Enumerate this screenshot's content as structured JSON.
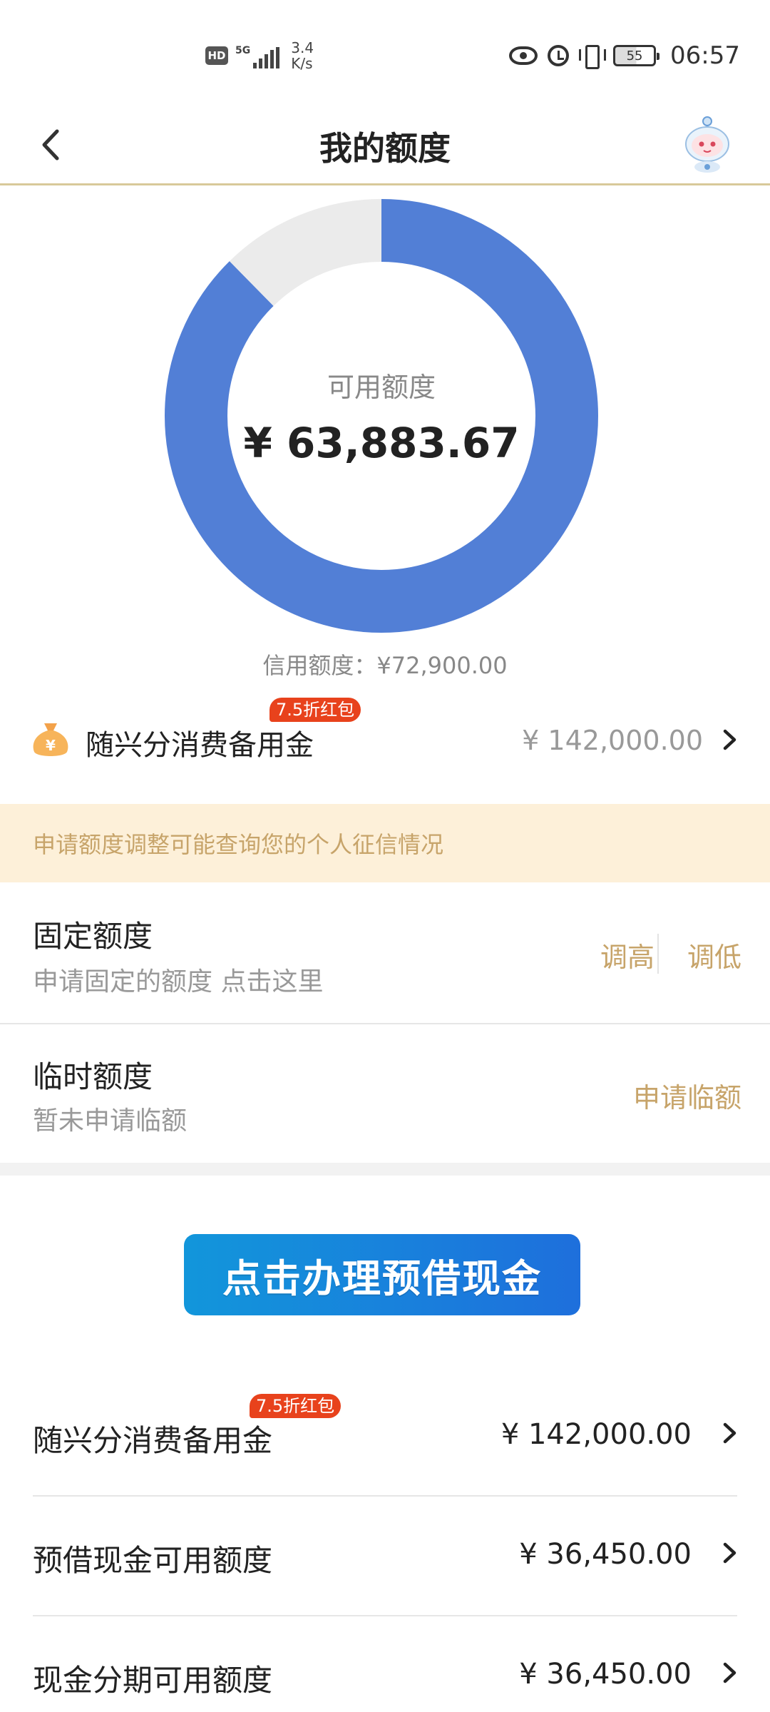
{
  "status_bar": {
    "hd": "HD",
    "network": "5G",
    "speed_value": "3.4",
    "speed_unit": "K/s",
    "battery": "55",
    "time": "06:57",
    "icons": [
      "eye-icon",
      "alarm-icon",
      "vibrate-icon",
      "battery-icon"
    ]
  },
  "header": {
    "title": "我的额度",
    "back_icon": "chevron-left-icon",
    "avatar_icon": "robot-assistant-icon"
  },
  "credit_summary": {
    "available_label": "可用额度",
    "available_amount": "¥ 63,883.67",
    "credit_limit_label": "信用额度：",
    "credit_limit_value": "¥72,900.00",
    "used_fraction": 0.1237,
    "colors": {
      "available": "#527fd6",
      "used": "#ebebeb"
    }
  },
  "reserve": {
    "label": "随兴分消费备用金",
    "badge": "7.5折红包",
    "amount": "¥ 142,000.00",
    "icon": "money-bag-icon"
  },
  "notice": {
    "text": "申请额度调整可能查询您的个人征信情况"
  },
  "fixed_quota": {
    "title": "固定额度",
    "subtitle": "申请固定的额度 点击这里",
    "raise": "调高",
    "lower": "调低"
  },
  "temp_quota": {
    "title": "临时额度",
    "subtitle": "暂未申请临额",
    "apply": "申请临额"
  },
  "banner": {
    "text": "点击办理预借现金"
  },
  "list": [
    {
      "label": "随兴分消费备用金",
      "amount": "¥ 142,000.00",
      "badge": "7.5折红包"
    },
    {
      "label": "预借现金可用额度",
      "amount": "¥ 36,450.00"
    },
    {
      "label": "现金分期可用额度",
      "amount": "¥ 36,450.00"
    }
  ],
  "colors": {
    "accent_gold": "#c7a46a",
    "notice_bg": "#fdf0d9",
    "badge_red": "#e8421c",
    "banner_blue": "#1296db"
  }
}
